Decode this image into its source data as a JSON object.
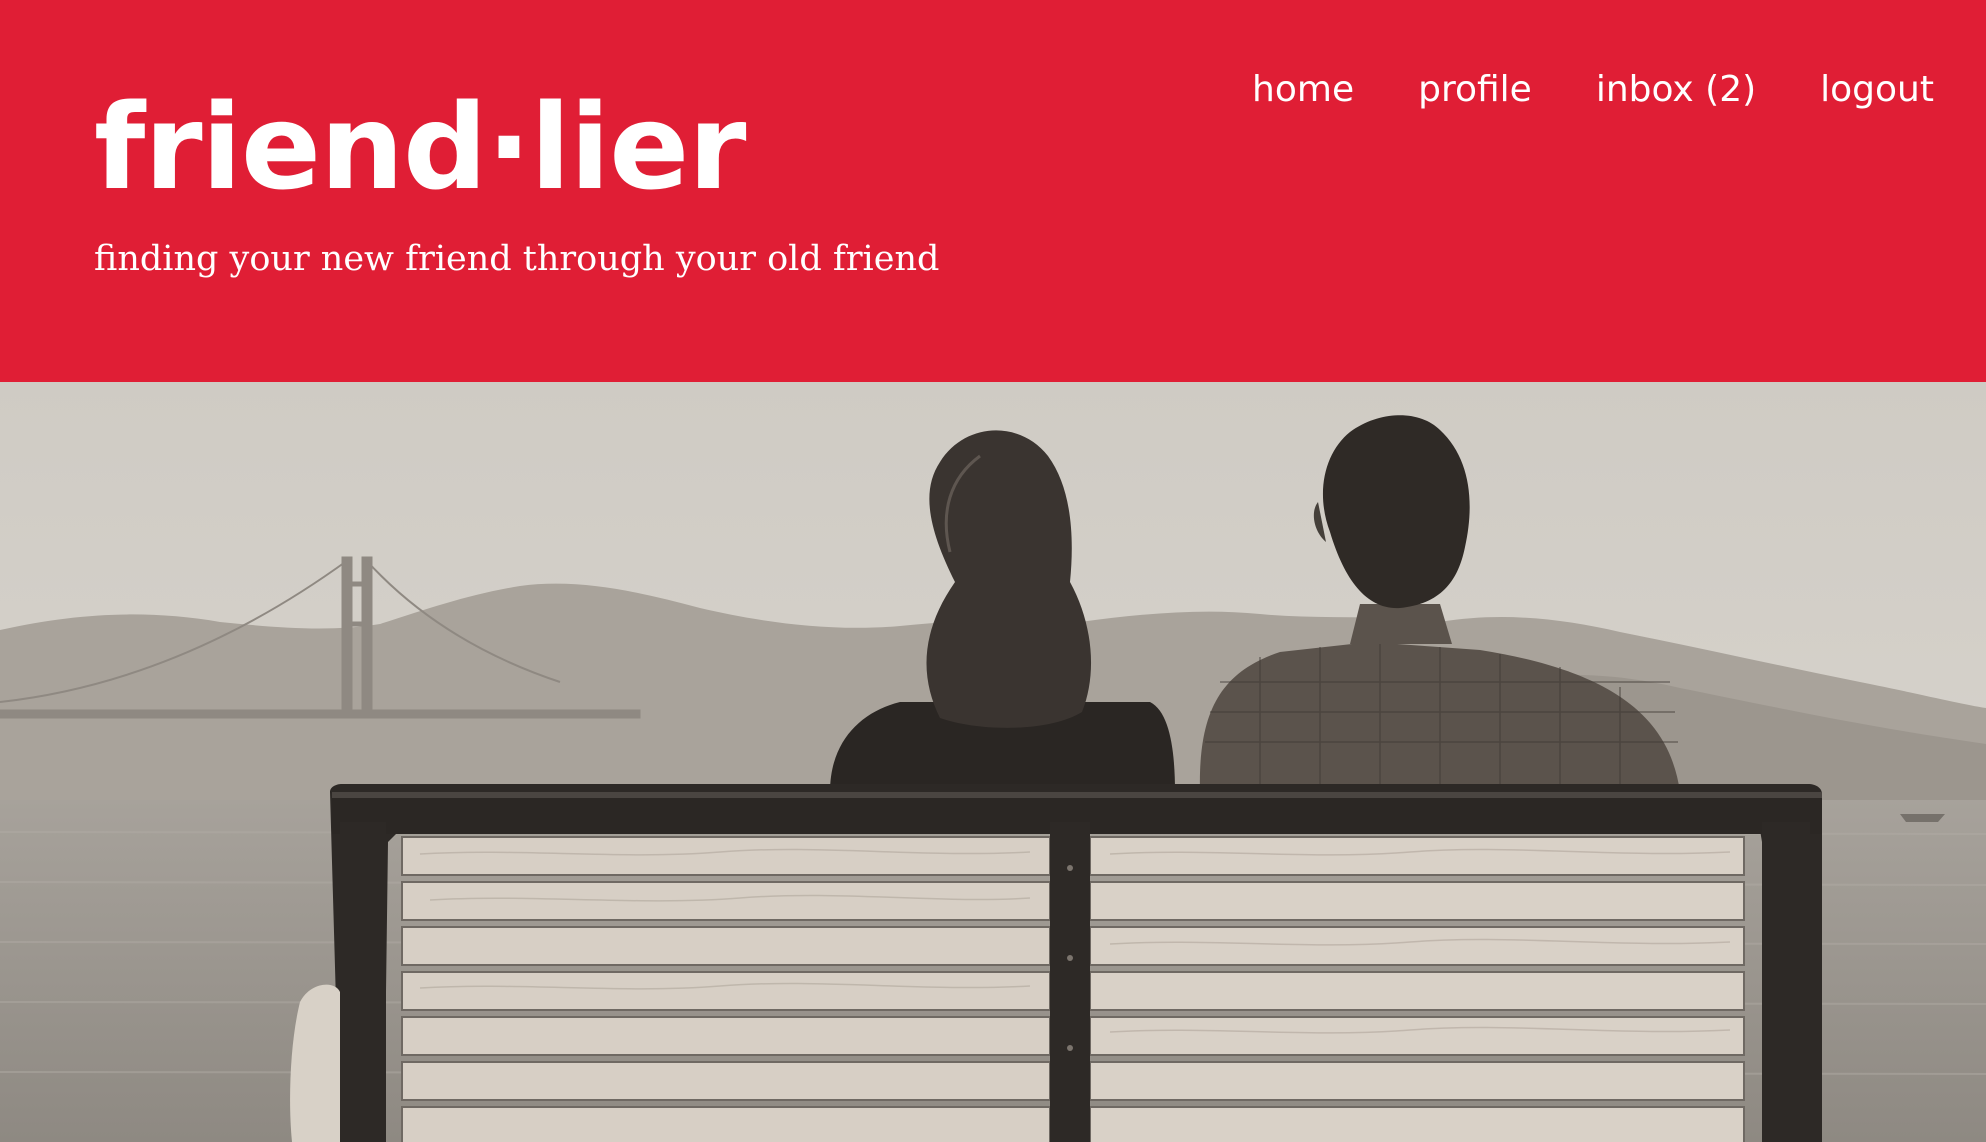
{
  "brand": {
    "logo": "friend·lier",
    "tagline": "finding your new friend through your old friend",
    "accent_color": "#e01e35"
  },
  "nav": {
    "items": [
      {
        "label": "home"
      },
      {
        "label": "profile"
      },
      {
        "label": "inbox (2)"
      },
      {
        "label": "logout"
      }
    ]
  },
  "hero": {
    "image": "hero-photo",
    "tone": "sepia"
  }
}
